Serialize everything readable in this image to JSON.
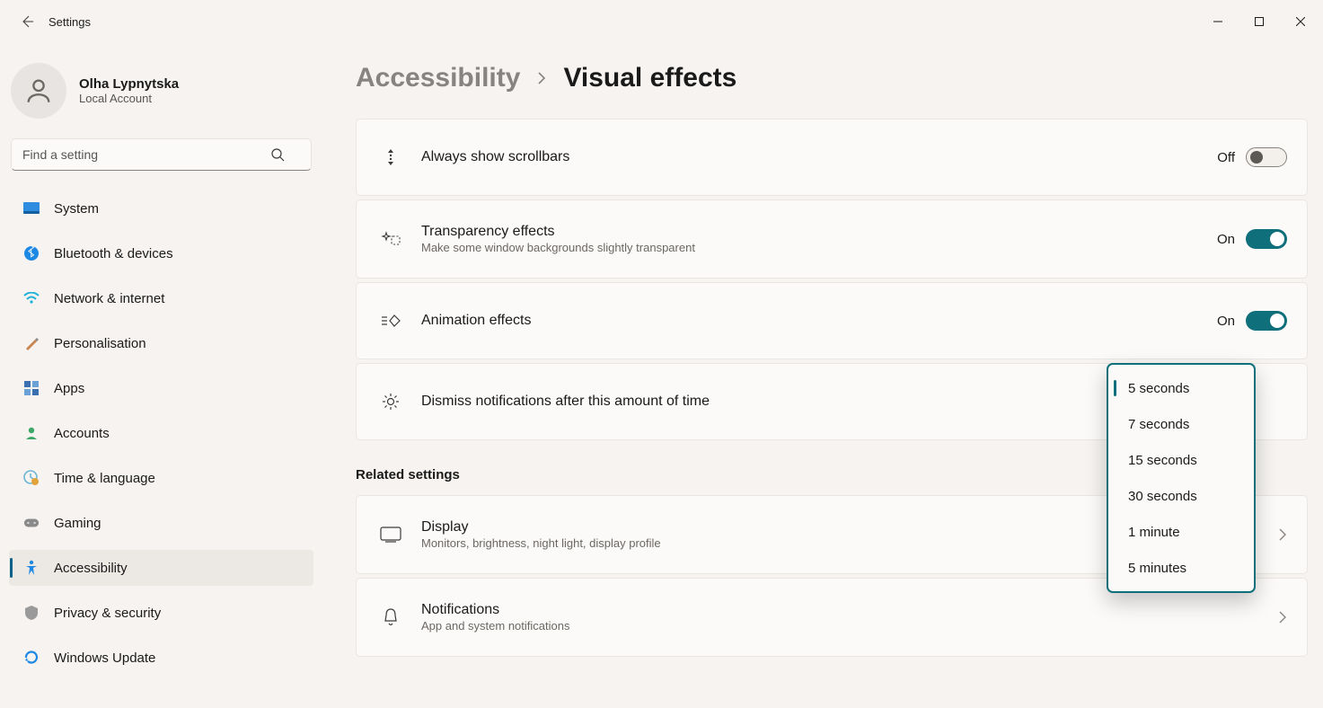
{
  "window": {
    "title": "Settings"
  },
  "user": {
    "name": "Olha Lypnytska",
    "sub": "Local Account"
  },
  "search": {
    "placeholder": "Find a setting"
  },
  "nav": {
    "items": [
      {
        "label": "System"
      },
      {
        "label": "Bluetooth & devices"
      },
      {
        "label": "Network & internet"
      },
      {
        "label": "Personalisation"
      },
      {
        "label": "Apps"
      },
      {
        "label": "Accounts"
      },
      {
        "label": "Time & language"
      },
      {
        "label": "Gaming"
      },
      {
        "label": "Accessibility"
      },
      {
        "label": "Privacy & security"
      },
      {
        "label": "Windows Update"
      }
    ]
  },
  "breadcrumb": {
    "parent": "Accessibility",
    "current": "Visual effects"
  },
  "settings": {
    "scrollbars": {
      "title": "Always show scrollbars",
      "state": "Off"
    },
    "transparency": {
      "title": "Transparency effects",
      "sub": "Make some window backgrounds slightly transparent",
      "state": "On"
    },
    "animation": {
      "title": "Animation effects",
      "state": "On"
    },
    "dismiss": {
      "title": "Dismiss notifications after this amount of time"
    }
  },
  "related": {
    "heading": "Related settings",
    "display": {
      "title": "Display",
      "sub": "Monitors, brightness, night light, display profile"
    },
    "notifications": {
      "title": "Notifications",
      "sub": "App and system notifications"
    }
  },
  "dropdown": {
    "options": [
      {
        "label": "5 seconds"
      },
      {
        "label": "7 seconds"
      },
      {
        "label": "15 seconds"
      },
      {
        "label": "30 seconds"
      },
      {
        "label": "1 minute"
      },
      {
        "label": "5 minutes"
      }
    ],
    "selected_index": 0
  }
}
